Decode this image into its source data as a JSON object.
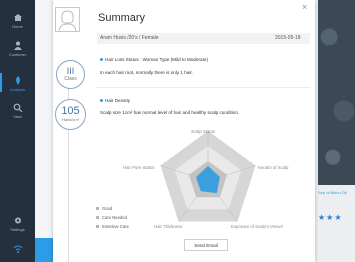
{
  "sidebar": {
    "items": [
      {
        "label": "Home",
        "icon": "home-icon"
      },
      {
        "label": "Customer",
        "icon": "customer-icon"
      },
      {
        "label": "Analysis",
        "icon": "analysis-icon",
        "active": true
      },
      {
        "label": "View",
        "icon": "magnifier-icon"
      },
      {
        "label": "Settings",
        "icon": "gear-icon"
      }
    ],
    "wifi_icon": "wifi-icon"
  },
  "background": {
    "partial_text": "Sep of Menu Ok",
    "stars": "★★★"
  },
  "summary": {
    "title": "Summary",
    "patient": "Aram Huvis /20's / Female",
    "date": "2015-05-18",
    "hair_loss": {
      "badge_value": "III",
      "badge_unit": "Class",
      "heading": "Hair Loss Status : Woman Type (Mild to Moderate)",
      "description": "In each hair root, normally there is only 1 hair."
    },
    "hair_density": {
      "badge_value": "105",
      "badge_unit": "Hairs/cm²",
      "heading": "Hair Density",
      "description": "Scalp size 1cm² has normal level of hair and healthy scalp condition."
    },
    "radar": {
      "axes": [
        "Scalp Status",
        "Keratin of Scalp",
        "Exposure of Scalp's Vessel",
        "Hair Thickness",
        "Hair Pore Status"
      ],
      "levels": [
        "Good",
        "Care Needed",
        "Intensive Care"
      ],
      "values": [
        0.3,
        0.25,
        0.3,
        0.25,
        0.25
      ]
    },
    "send_button": "Send Email",
    "close": "×"
  },
  "colors": {
    "accent": "#2d9ce6",
    "sidebar": "#24303d",
    "radar_outer": "#d6d6d6",
    "radar_mid": "#e9e9e9",
    "radar_inner": "#c3c3c3",
    "radar_value": "#3c9fdd"
  }
}
